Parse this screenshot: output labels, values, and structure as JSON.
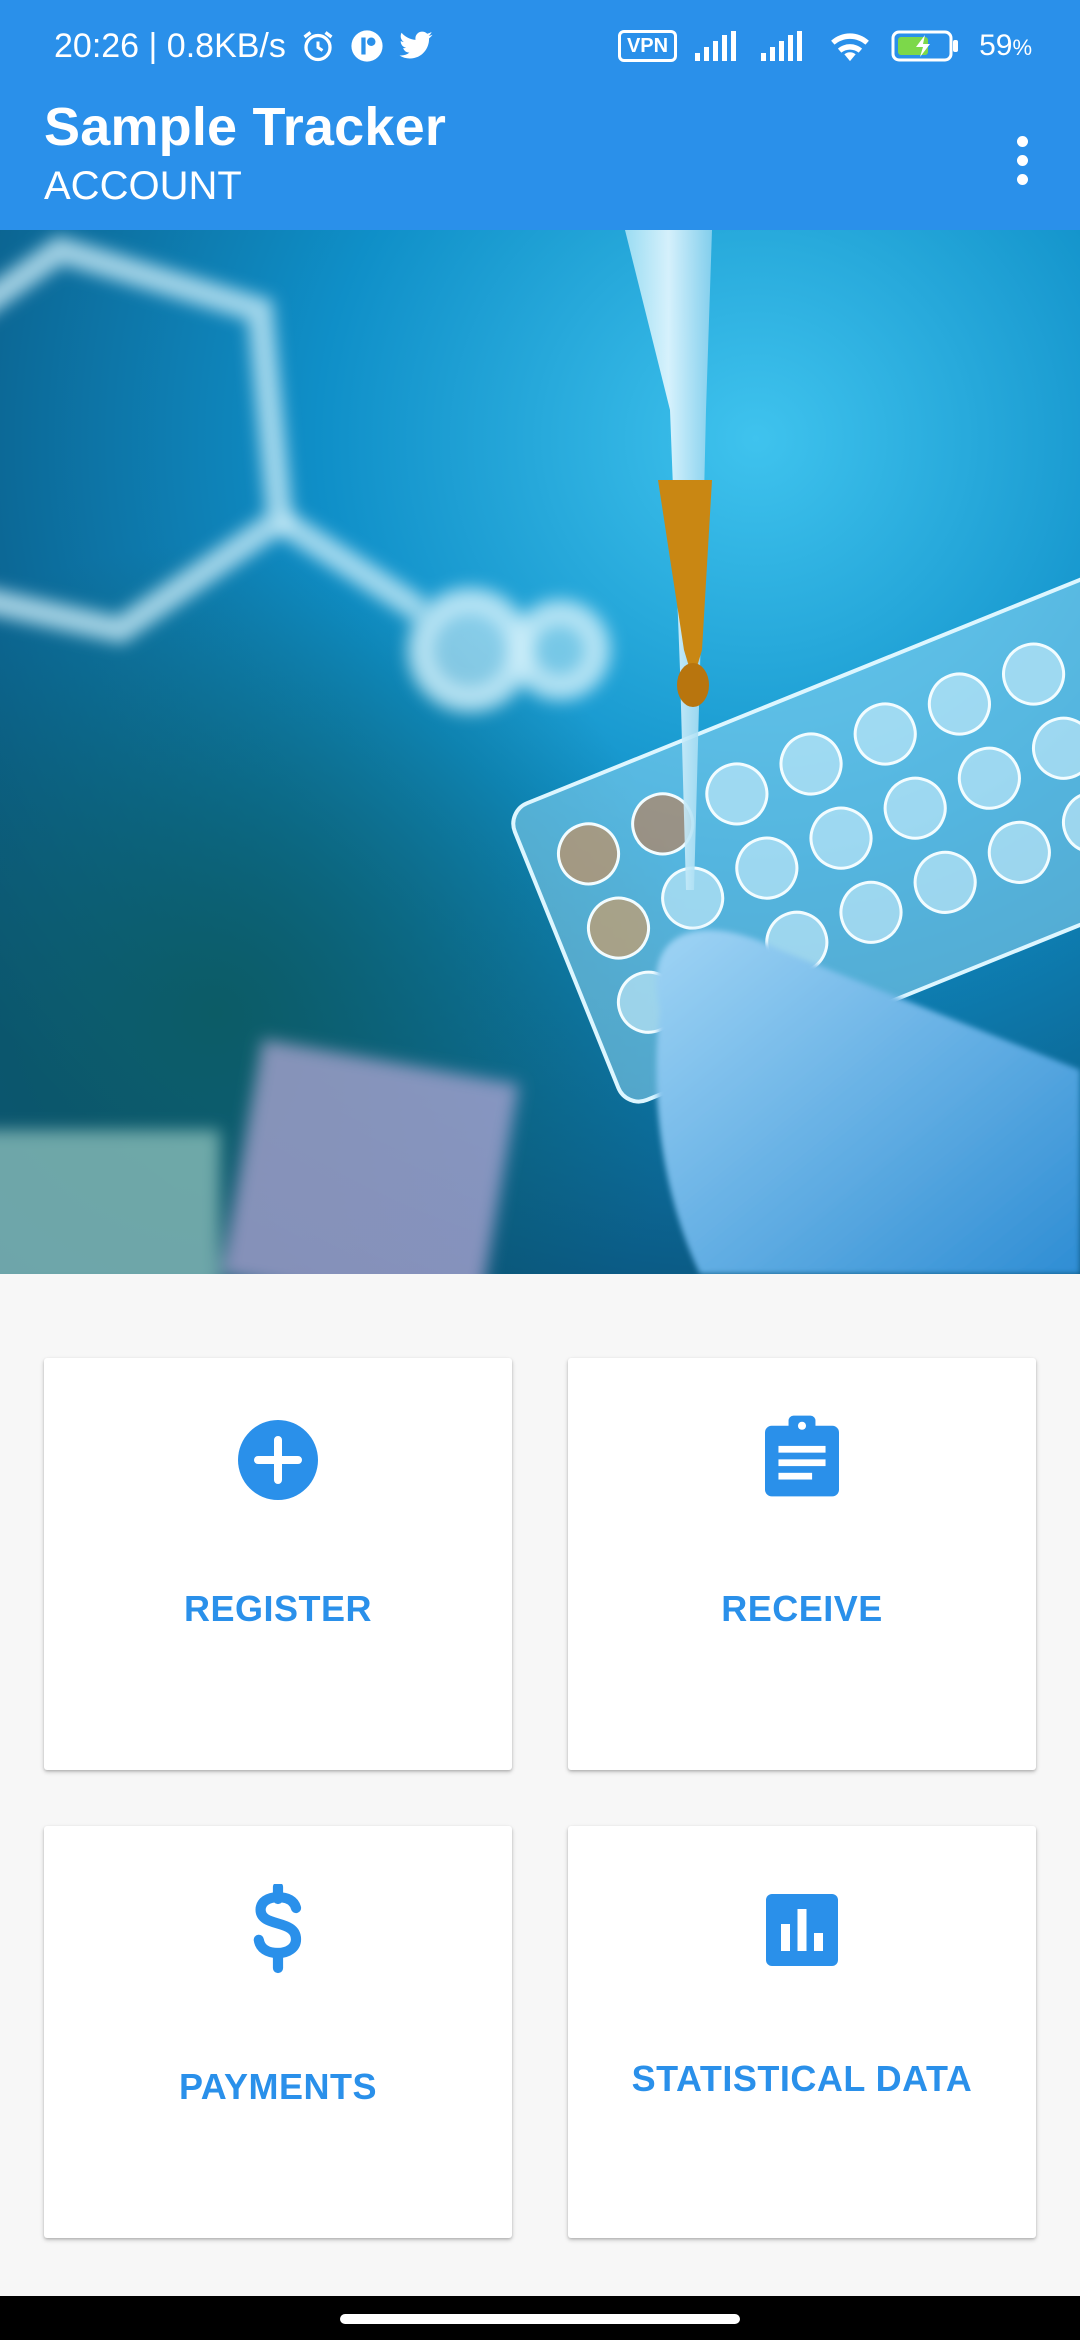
{
  "status_bar": {
    "time_speed": "20:26 | 0.8KB/s",
    "vpn": "VPN",
    "battery": "59",
    "battery_unit": "%",
    "icons": [
      "alarm-icon",
      "app-notification-icon",
      "twitter-icon",
      "vpn-icon",
      "signal-icon",
      "signal-icon",
      "wifi-icon",
      "battery-charging-icon"
    ]
  },
  "app_bar": {
    "title": "Sample Tracker",
    "subtitle": "ACCOUNT",
    "menu_icon": "more-vert-icon"
  },
  "hero": {
    "description_icon": "lab-image"
  },
  "actions": [
    {
      "label": "REGISTER",
      "icon": "add-circle-icon"
    },
    {
      "label": "RECEIVE",
      "icon": "clipboard-icon"
    },
    {
      "label": "PAYMENTS",
      "icon": "dollar-icon"
    },
    {
      "label": "STATISTICAL DATA",
      "icon": "bar-chart-icon"
    }
  ],
  "colors": {
    "primary": "#2A90EA",
    "background": "#F7F7F7",
    "card": "#FFFFFF"
  }
}
